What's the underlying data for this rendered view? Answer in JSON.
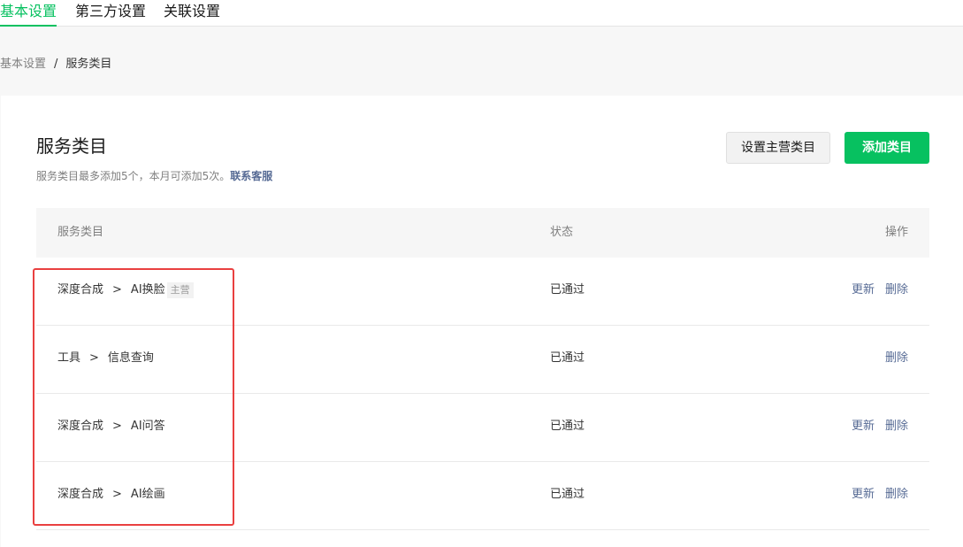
{
  "topnav": {
    "tabs": [
      {
        "label": "基本设置",
        "active": true
      },
      {
        "label": "第三方设置",
        "active": false
      },
      {
        "label": "关联设置",
        "active": false
      }
    ]
  },
  "breadcrumb": {
    "items": [
      "基本设置",
      "服务类目"
    ],
    "separator": "/"
  },
  "section": {
    "title": "服务类目",
    "description": "服务类目最多添加5个，本月可添加5次。",
    "contact_link": "联系客服"
  },
  "buttons": {
    "set_main": "设置主营类目",
    "add": "添加类目"
  },
  "table": {
    "headers": {
      "category": "服务类目",
      "status": "状态",
      "ops": "操作"
    },
    "rows": [
      {
        "parent": "深度合成",
        "arrow": ">",
        "child": "AI换脸",
        "badge": "主营",
        "status": "已通过",
        "update": "更新",
        "delete": "删除"
      },
      {
        "parent": "工具",
        "arrow": ">",
        "child": "信息查询",
        "status": "已通过",
        "delete": "删除"
      },
      {
        "parent": "深度合成",
        "arrow": ">",
        "child": "AI问答",
        "status": "已通过",
        "update": "更新",
        "delete": "删除"
      },
      {
        "parent": "深度合成",
        "arrow": ">",
        "child": "AI绘画",
        "status": "已通过",
        "update": "更新",
        "delete": "删除"
      }
    ]
  },
  "colors": {
    "brand": "#07c160",
    "link": "#576b95",
    "highlight": "#e94040"
  }
}
